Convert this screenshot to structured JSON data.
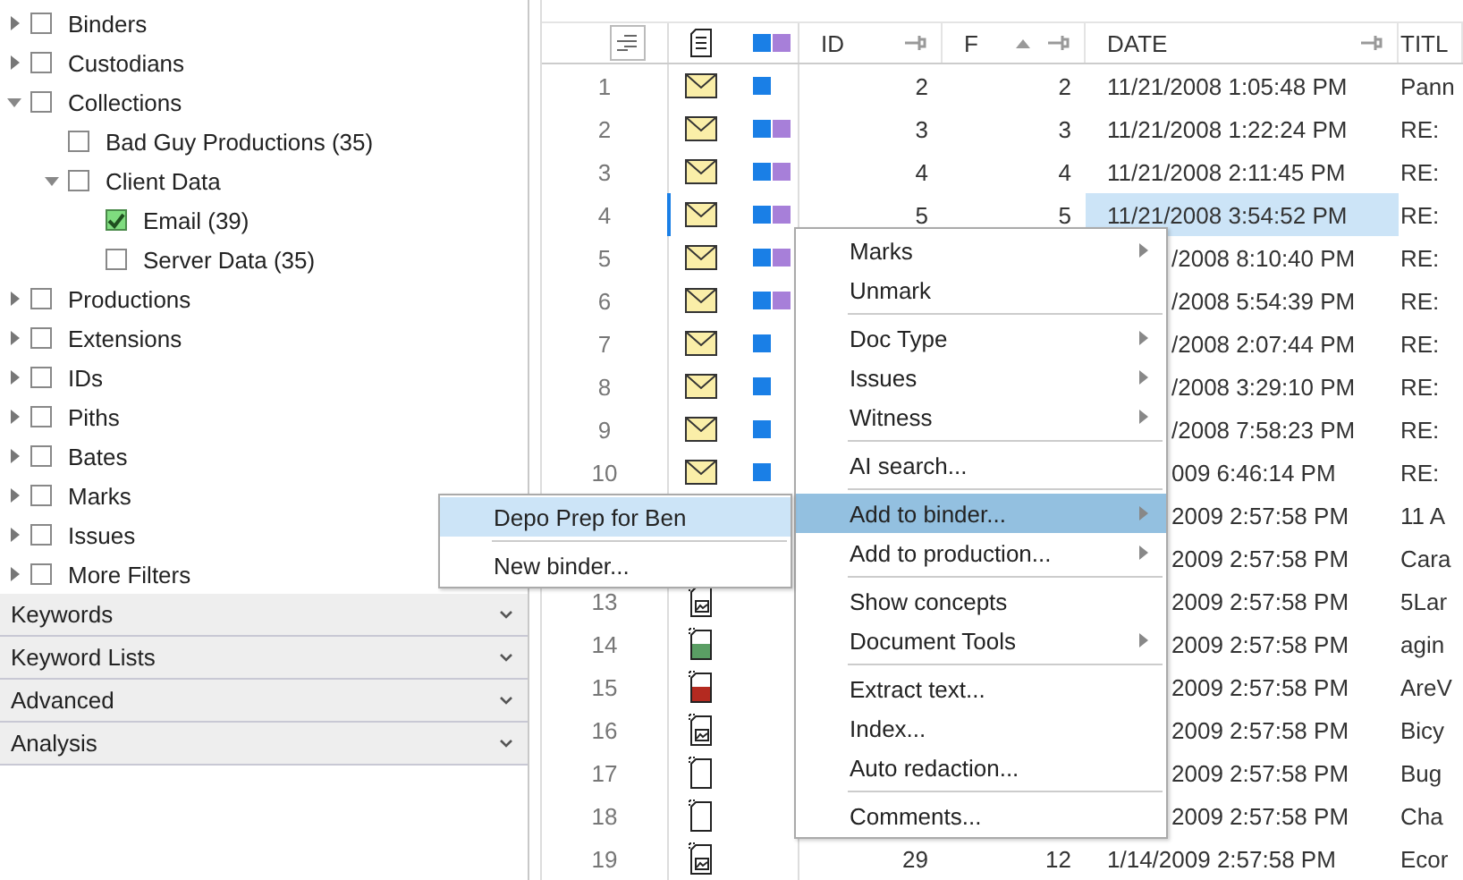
{
  "filter_tree": [
    {
      "label": "Binders",
      "checked": false,
      "expanded": false
    },
    {
      "label": "Custodians",
      "checked": false,
      "expanded": false
    },
    {
      "label": "Collections",
      "checked": false,
      "expanded": true,
      "children": [
        {
          "label": "Bad Guy Productions (35)",
          "checked": false
        },
        {
          "label": "Client Data",
          "checked": false,
          "expanded": true,
          "children": [
            {
              "label": "Email (39)",
              "checked": true
            },
            {
              "label": "Server Data (35)",
              "checked": false
            }
          ]
        }
      ]
    },
    {
      "label": "Productions",
      "checked": false,
      "expanded": false
    },
    {
      "label": "Extensions",
      "checked": false,
      "expanded": false
    },
    {
      "label": "IDs",
      "checked": false,
      "expanded": false
    },
    {
      "label": "Piths",
      "checked": false,
      "expanded": false
    },
    {
      "label": "Bates",
      "checked": false,
      "expanded": false
    },
    {
      "label": "Marks",
      "checked": false,
      "expanded": false
    },
    {
      "label": "Issues",
      "checked": false,
      "expanded": false
    },
    {
      "label": "More Filters",
      "checked": false,
      "expanded": false
    }
  ],
  "sections": [
    {
      "label": "Keywords",
      "expanded": false
    },
    {
      "label": "Keyword Lists",
      "expanded": false
    },
    {
      "label": "Advanced",
      "expanded": false
    },
    {
      "label": "Analysis",
      "expanded": false
    }
  ],
  "grid": {
    "columns": [
      {
        "label": "ID",
        "pinned": true,
        "sorted": false
      },
      {
        "label": "F",
        "pinned": true,
        "sorted": true
      },
      {
        "label": "DATE",
        "pinned": true,
        "sorted": false
      },
      {
        "label": "TITL",
        "sorted": false
      }
    ],
    "rows": [
      {
        "number": "1",
        "kind": "email",
        "marks": [
          {
            "color": "#1a7fe6"
          }
        ],
        "id": "2",
        "fa": "2",
        "date": "11/21/2008 1:05:48 PM",
        "title": "Pann",
        "selected": false
      },
      {
        "number": "2",
        "kind": "email",
        "marks": [
          {
            "color": "#1a7fe6"
          },
          {
            "color": "#a77fd9"
          }
        ],
        "id": "3",
        "fa": "3",
        "date": "11/21/2008 1:22:24 PM",
        "title": "RE:",
        "selected": false
      },
      {
        "number": "3",
        "kind": "email",
        "marks": [
          {
            "color": "#1a7fe6"
          },
          {
            "color": "#a77fd9"
          }
        ],
        "id": "4",
        "fa": "4",
        "date": "11/21/2008 2:11:45 PM",
        "title": "RE:",
        "selected": false
      },
      {
        "number": "4",
        "kind": "email",
        "marks": [
          {
            "color": "#1a7fe6"
          },
          {
            "color": "#a77fd9"
          }
        ],
        "id": "5",
        "fa": "5",
        "date": "11/21/2008 3:54:52 PM",
        "title": "RE:",
        "selected": true
      },
      {
        "number": "5",
        "kind": "email",
        "marks": [
          {
            "color": "#1a7fe6"
          },
          {
            "color": "#a77fd9"
          }
        ],
        "date": "/2008 8:10:40 PM",
        "title": "RE:",
        "selected": false
      },
      {
        "number": "6",
        "kind": "email",
        "marks": [
          {
            "color": "#1a7fe6"
          },
          {
            "color": "#a77fd9"
          }
        ],
        "date": "/2008 5:54:39 PM",
        "title": "RE:",
        "selected": false
      },
      {
        "number": "7",
        "kind": "email",
        "marks": [
          {
            "color": "#1a7fe6"
          }
        ],
        "date": "/2008 2:07:44 PM",
        "title": "RE:",
        "selected": false
      },
      {
        "number": "8",
        "kind": "email",
        "marks": [
          {
            "color": "#1a7fe6"
          }
        ],
        "date": "/2008 3:29:10 PM",
        "title": "RE:",
        "selected": false
      },
      {
        "number": "9",
        "kind": "email",
        "marks": [
          {
            "color": "#1a7fe6"
          }
        ],
        "date": "/2008 7:58:23 PM",
        "title": "RE:",
        "selected": false
      },
      {
        "number": "10",
        "kind": "email",
        "marks": [
          {
            "color": "#1a7fe6"
          }
        ],
        "date": "009 6:46:14 PM",
        "title": "RE:",
        "selected": false
      },
      {
        "date": "2009 2:57:58 PM",
        "title": "11 A",
        "selected": false
      },
      {
        "date": "2009 2:57:58 PM",
        "title": "Cara",
        "selected": false
      },
      {
        "number": "13",
        "kind": "image",
        "date": "2009 2:57:58 PM",
        "title": "5Lar",
        "selected": false
      },
      {
        "number": "14",
        "kind": "green",
        "date": "2009 2:57:58 PM",
        "title": "agin",
        "selected": false
      },
      {
        "number": "15",
        "kind": "red",
        "date": "2009 2:57:58 PM",
        "title": "AreV",
        "selected": false
      },
      {
        "number": "16",
        "kind": "image",
        "date": "2009 2:57:58 PM",
        "title": "Bicy",
        "selected": false
      },
      {
        "number": "17",
        "kind": "blank",
        "date": "2009 2:57:58 PM",
        "title": "Bug",
        "selected": false
      },
      {
        "number": "18",
        "kind": "blank",
        "date": "2009 2:57:58 PM",
        "title": "Cha",
        "selected": false
      },
      {
        "number": "19",
        "kind": "image",
        "id": "29",
        "fa": "12",
        "date": "1/14/2009 2:57:58 PM",
        "title": "Ecor",
        "selected": false
      }
    ]
  },
  "context_menu": {
    "groups": [
      [
        {
          "label": "Marks",
          "submenu": true,
          "selected": false
        },
        {
          "label": "Unmark",
          "submenu": false,
          "selected": false
        }
      ],
      [
        {
          "label": "Doc Type",
          "submenu": true,
          "selected": false
        },
        {
          "label": "Issues",
          "submenu": true,
          "selected": false
        },
        {
          "label": "Witness",
          "submenu": true,
          "selected": false
        }
      ],
      [
        {
          "label": "AI search...",
          "submenu": false,
          "selected": false
        }
      ],
      [
        {
          "label": "Add to binder...",
          "submenu": true,
          "selected": true
        },
        {
          "label": "Add to production...",
          "submenu": true,
          "selected": false
        }
      ],
      [
        {
          "label": "Show concepts",
          "submenu": false,
          "selected": false
        },
        {
          "label": "Document Tools",
          "submenu": true,
          "selected": false
        }
      ],
      [
        {
          "label": "Extract text...",
          "submenu": false,
          "selected": false
        },
        {
          "label": "Index...",
          "submenu": false,
          "selected": false
        },
        {
          "label": "Auto redaction...",
          "submenu": false,
          "selected": false
        }
      ],
      [
        {
          "label": "Comments...",
          "submenu": false,
          "selected": false
        }
      ]
    ]
  },
  "binder_submenu": {
    "groups": [
      [
        {
          "label": "Depo Prep for Ben",
          "selected": true
        }
      ],
      [
        {
          "label": "New binder...",
          "selected": false
        }
      ]
    ]
  }
}
